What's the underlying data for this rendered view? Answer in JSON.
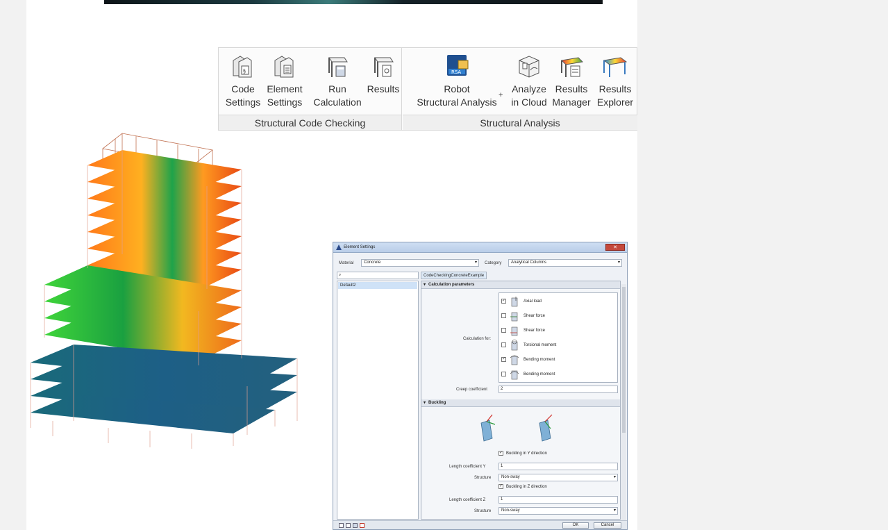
{
  "ribbon": {
    "groups": [
      {
        "title": "Structural Code Checking",
        "buttons": [
          {
            "label": "Code\nSettings",
            "icon": "code-settings-icon"
          },
          {
            "label": "Element\nSettings",
            "icon": "element-settings-icon"
          },
          {
            "label": "Run\nCalculation",
            "icon": "run-calculation-icon"
          },
          {
            "label": "Results",
            "icon": "results-icon"
          }
        ]
      },
      {
        "title": "Structural Analysis",
        "buttons": [
          {
            "label": "Robot\nStructural Analysis",
            "icon": "robot-structural-analysis-icon"
          },
          {
            "label": "Analyze\nin Cloud",
            "icon": "analyze-in-cloud-icon"
          },
          {
            "label": "Results\nManager",
            "icon": "results-manager-icon"
          },
          {
            "label": "Results\nExplorer",
            "icon": "results-explorer-icon"
          }
        ]
      }
    ],
    "plus": "+"
  },
  "dialog": {
    "title": "Element Settings",
    "close": "✕",
    "material_label": "Material",
    "material_value": "Concrete",
    "category_label": "Category",
    "category_value": "Analytical Columns",
    "search_placeholder": "",
    "search_icon": "⌕",
    "list_items": [
      "Default2"
    ],
    "tab": "CodeCheckingConcreteExample",
    "calc_section": "Calculation parameters",
    "calc_for_label": "Calculation for:",
    "checks": [
      {
        "label": "Axial load",
        "checked": true
      },
      {
        "label": "Shear force",
        "checked": false
      },
      {
        "label": "Shear force",
        "checked": false
      },
      {
        "label": "Torsional moment",
        "checked": false
      },
      {
        "label": "Bending moment",
        "checked": true
      },
      {
        "label": "Bending moment",
        "checked": false
      }
    ],
    "creep_label": "Creep coefficient",
    "creep_value": "2",
    "buckling_section": "Buckling",
    "buckling_y_label": "Buckling in Y direction",
    "length_y_label": "Length coefficient Y",
    "length_y_value": "1",
    "structure_label": "Structure",
    "structure_y_value": "Non-sway",
    "buckling_z_label": "Buckling in Z direction",
    "length_z_label": "Length coefficient Z",
    "length_z_value": "1",
    "structure_z_value": "Non-sway",
    "ok": "OK",
    "cancel": "Cancel"
  }
}
